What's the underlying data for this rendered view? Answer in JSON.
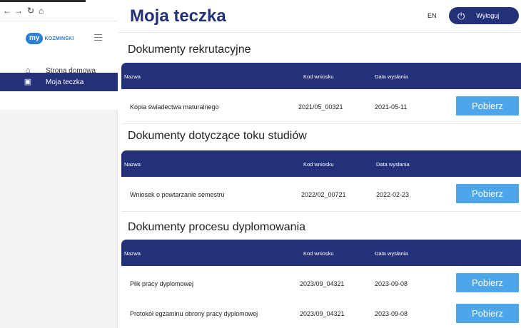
{
  "browser": {
    "back": "←",
    "forward": "→",
    "reload": "↻",
    "home": "⌂"
  },
  "logo": {
    "my": "my",
    "brand": "KOZMINSKI"
  },
  "sidebar": {
    "items": [
      {
        "label": "Strona domowa",
        "icon": "home-icon",
        "active": false
      },
      {
        "label": "Moja teczka",
        "icon": "folder-icon",
        "active": true
      }
    ]
  },
  "header": {
    "title": "Moja teczka",
    "lang": "EN",
    "logout_label": "Wyloguj"
  },
  "columns": {
    "name": "Nazwa",
    "code": "Kod wniosku",
    "date": "Data wysłania"
  },
  "download_label": "Pobierz",
  "sections": [
    {
      "title": "Dokumenty rekrutacyjne",
      "rows": [
        {
          "name": "Kopia świadectwa maturalnego",
          "code": "2021/05_00321",
          "date": "2021-05-11"
        }
      ]
    },
    {
      "title": "Dokumenty dotyczące toku studiów",
      "rows": [
        {
          "name": "Wniosek o powtarzanie semestru",
          "code": "2022/02_00721",
          "date": "2022-02-23"
        }
      ]
    },
    {
      "title": "Dokumenty procesu dyplomowania",
      "rows": [
        {
          "name": "Plik pracy dyplomowej",
          "code": "2023/09_04321",
          "date": "2023-09-08"
        },
        {
          "name": "Protokół egzaminu obrony pracy dyplomowej",
          "code": "2023/09_04321",
          "date": "2023-09-08"
        }
      ]
    }
  ],
  "colors": {
    "navy": "#23307a",
    "button": "#4da6ea",
    "logo_blue": "#2d7fd3"
  }
}
